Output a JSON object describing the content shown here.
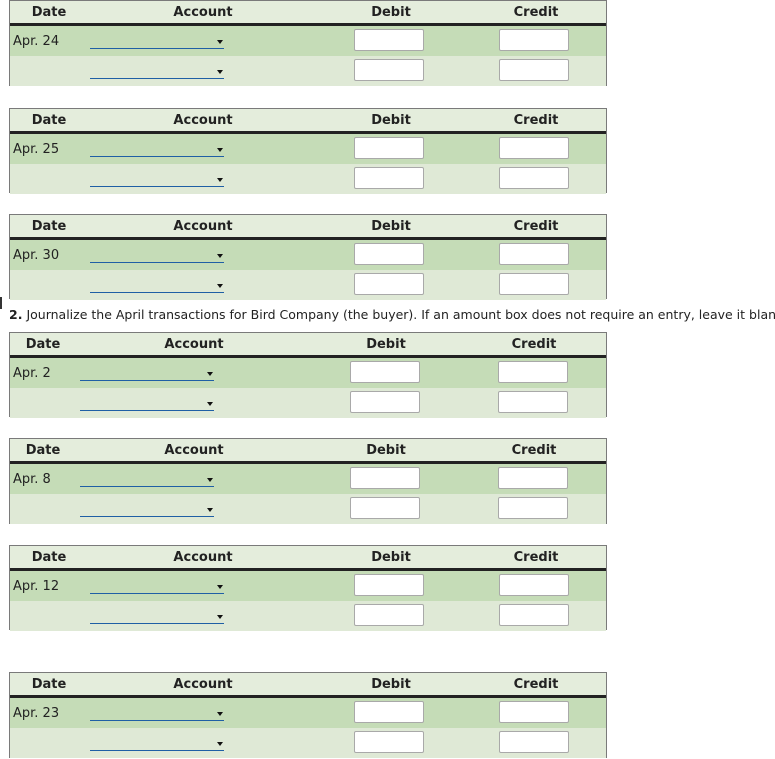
{
  "headers": {
    "date": "Date",
    "account": "Account",
    "debit": "Debit",
    "credit": "Credit"
  },
  "instruction": {
    "number": "2.",
    "text": "Journalize the April transactions for Bird Company (the buyer). If an amount box does not require an entry, leave it blank."
  },
  "section1": [
    {
      "date": "Apr. 24"
    },
    {
      "date": "Apr. 25"
    },
    {
      "date": "Apr. 30"
    }
  ],
  "section2": [
    {
      "date": "Apr. 2"
    },
    {
      "date": "Apr. 8"
    },
    {
      "date": "Apr. 12"
    },
    {
      "date": "Apr. 23"
    }
  ],
  "account_select": {
    "value": ""
  },
  "amount_input": {
    "value": ""
  }
}
